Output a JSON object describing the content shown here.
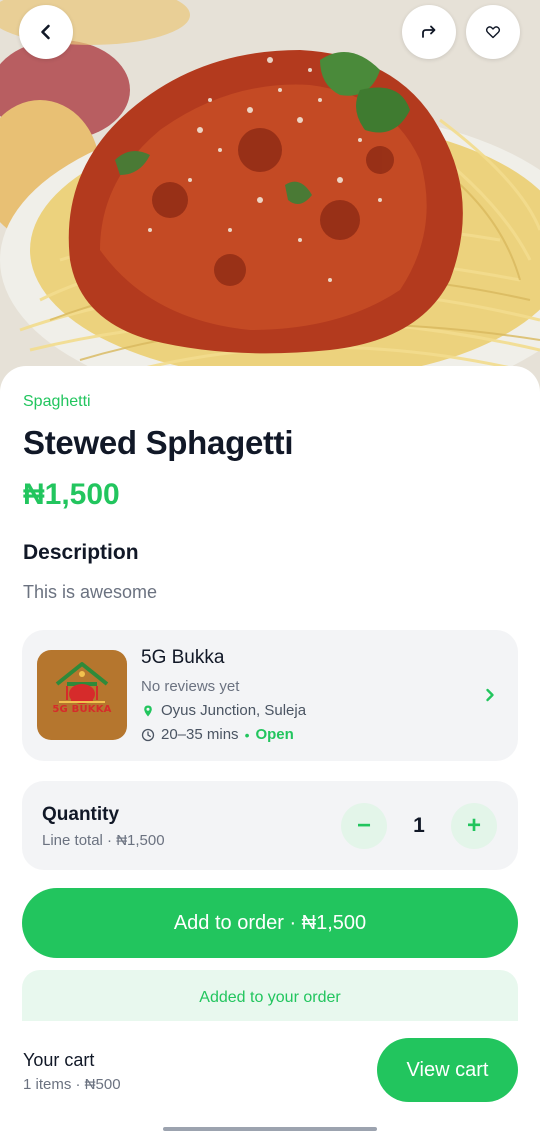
{
  "product": {
    "category": "Spaghetti",
    "name": "Stewed Sphagetti",
    "price": "₦1,500",
    "description_heading": "Description",
    "description": "This is awesome"
  },
  "vendor": {
    "name": "5G Bukka",
    "logo_text": "5G BUKKA",
    "reviews": "No reviews yet",
    "location": "Oyus Junction, Suleja",
    "delivery_time": "20–35 mins",
    "separator": "•",
    "status": "Open"
  },
  "quantity": {
    "label": "Quantity",
    "line_total": "Line total · ₦1,500",
    "value": "1",
    "minus": "−",
    "plus": "+"
  },
  "actions": {
    "add_to_order": "Add to order · ₦1,500",
    "added_message": "Added to your order"
  },
  "cart": {
    "title": "Your cart",
    "summary": "1 items · ₦500",
    "view_button": "View cart"
  },
  "colors": {
    "accent": "#22c55e",
    "card_bg": "#f3f4f6",
    "accent_light": "#e8f8ee"
  },
  "icons": {
    "back": "chevron-left-icon",
    "share": "share-arrow-icon",
    "favorite": "heart-outline-icon",
    "location": "map-pin-icon",
    "time": "clock-icon",
    "chevron": "chevron-right-icon"
  }
}
